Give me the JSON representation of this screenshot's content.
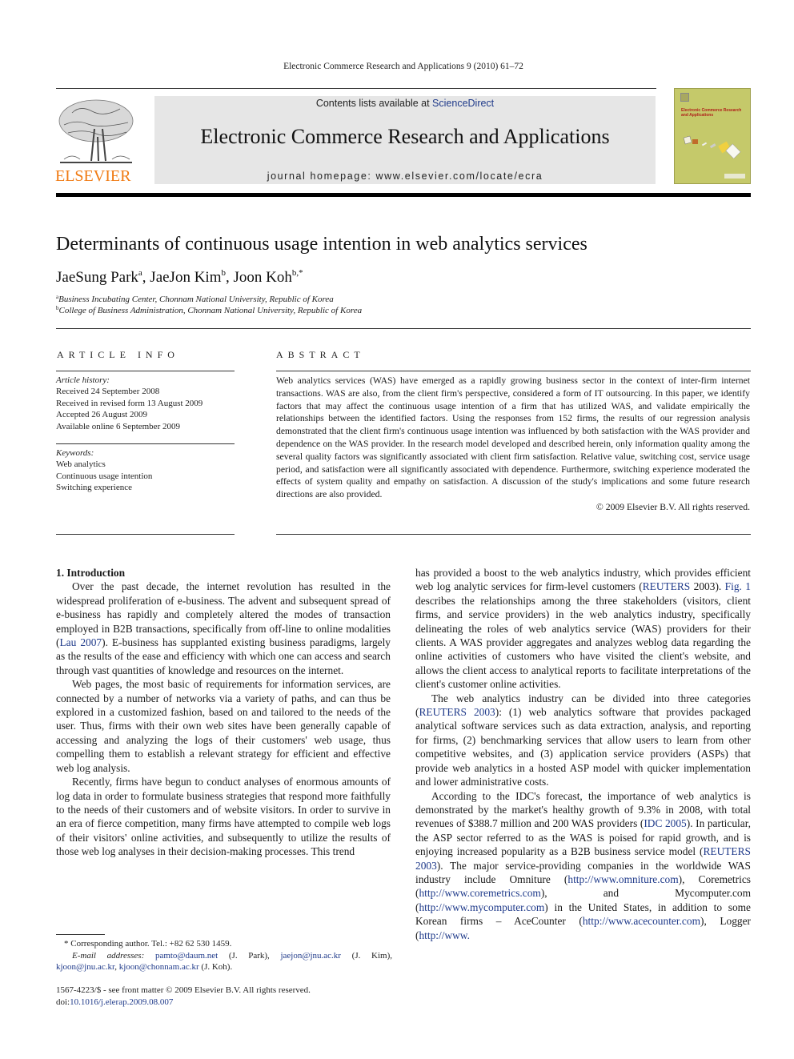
{
  "running_head": "Electronic Commerce Research and Applications 9 (2010) 61–72",
  "masthead": {
    "contents_prefix": "Contents lists available at ",
    "contents_link": "ScienceDirect",
    "journal_title": "Electronic Commerce Research and Applications",
    "homepage": "journal homepage: www.elsevier.com/locate/ecra",
    "publisher_logo": "ELSEVIER",
    "cover_title": "Electronic Commerce Research and Applications"
  },
  "colors": {
    "link": "#1f3a8a",
    "elsevier_orange": "#f07a12",
    "masthead_bg": "#e6e6e6",
    "cover_bg": "#c5c96a"
  },
  "article": {
    "title": "Determinants of continuous usage intention in web analytics services",
    "authors": [
      {
        "name": "JaeSung Park",
        "sup": "a",
        "sep": ", "
      },
      {
        "name": "JaeJon Kim",
        "sup": "b",
        "sep": ", "
      },
      {
        "name": "Joon Koh",
        "sup": "b,*",
        "sep": ""
      }
    ],
    "affiliations": [
      {
        "sup": "a",
        "text": "Business Incubating Center, Chonnam National University, Republic of Korea"
      },
      {
        "sup": "b",
        "text": "College of Business Administration, Chonnam National University, Republic of Korea"
      }
    ]
  },
  "article_info": {
    "heading": "ARTICLE INFO",
    "history_label": "Article history:",
    "history": [
      "Received 24 September 2008",
      "Received in revised form 13 August 2009",
      "Accepted 26 August 2009",
      "Available online 6 September 2009"
    ],
    "keywords_label": "Keywords:",
    "keywords": [
      "Web analytics",
      "Continuous usage intention",
      "Switching experience"
    ]
  },
  "abstract": {
    "heading": "ABSTRACT",
    "text": "Web analytics services (WAS) have emerged as a rapidly growing business sector in the context of inter-firm internet transactions. WAS are also, from the client firm's perspective, considered a form of IT outsourcing. In this paper, we identify factors that may affect the continuous usage intention of a firm that has utilized WAS, and validate empirically the relationships between the identified factors. Using the responses from 152 firms, the results of our regression analysis demonstrated that the client firm's continuous usage intention was influenced by both satisfaction with the WAS provider and dependence on the WAS provider. In the research model developed and described herein, only information quality among the several quality factors was significantly associated with client firm satisfaction. Relative value, switching cost, service usage period, and satisfaction were all significantly associated with dependence. Furthermore, switching experience moderated the effects of system quality and empathy on satisfaction. A discussion of the study's implications and some future research directions are also provided.",
    "copyright": "© 2009 Elsevier B.V. All rights reserved."
  },
  "body": {
    "section_heading": "1. Introduction",
    "left": {
      "p1_a": "Over the past decade, the internet revolution has resulted in the widespread proliferation of e-business. The advent and subsequent spread of e-business has rapidly and completely altered the modes of transaction employed in B2B transactions, specifically from off-line to online modalities (",
      "p1_cite": "Lau 2007",
      "p1_b": "). E-business has supplanted existing business paradigms, largely as the results of the ease and efficiency with which one can access and search through vast quantities of knowledge and resources on the internet.",
      "p2": "Web pages, the most basic of requirements for information services, are connected by a number of networks via a variety of paths, and can thus be explored in a customized fashion, based on and tailored to the needs of the user. Thus, firms with their own web sites have been generally capable of accessing and analyzing the logs of their customers' web usage, thus compelling them to establish a relevant strategy for efficient and effective web log analysis.",
      "p3": "Recently, firms have begun to conduct analyses of enormous amounts of log data in order to formulate business strategies that respond more faithfully to the needs of their customers and of website visitors. In order to survive in an era of fierce competition, many firms have attempted to compile web logs of their visitors' online activities, and subsequently to utilize the results of those web log analyses in their decision-making processes. This trend"
    },
    "right": {
      "p1_a": "has provided a boost to the web analytics industry, which provides efficient web log analytic services for firm-level customers (",
      "p1_cite1": "REUTERS",
      "p1_b": " 2003). ",
      "p1_fig": "Fig. 1",
      "p1_c": " describes the relationships among the three stakeholders (visitors, client firms, and service providers) in the web analytics industry, specifically delineating the roles of web analytics service (WAS) providers for their clients. A WAS provider aggregates and analyzes weblog data regarding the online activities of customers who have visited the client's website, and allows the client access to analytical reports to facilitate interpretations of the client's customer online activities.",
      "p2_a": "The web analytics industry can be divided into three categories (",
      "p2_cite": "REUTERS 2003",
      "p2_b": "): (1) web analytics software that provides packaged analytical software services such as data extraction, analysis, and reporting for firms, (2) benchmarking services that allow users to learn from other competitive websites, and (3) application service providers (ASPs) that provide web analytics in a hosted ASP model with quicker implementation and lower administrative costs.",
      "p3_a": "According to the IDC's forecast, the importance of web analytics is demonstrated by the market's healthy growth of 9.3% in 2008, with total revenues of $388.7 million and 200 WAS providers (",
      "p3_cite1": "IDC 2005",
      "p3_b": "). In particular, the ASP sector referred to as the WAS is poised for rapid growth, and is enjoying increased popularity as a B2B business service model (",
      "p3_cite2": "REUTERS 2003",
      "p3_c": "). The major service-providing companies in the worldwide WAS industry include Omniture (",
      "url1": "http://www.omniture.com",
      "p3_d": "), Coremetrics (",
      "url2": "http://www.coremetrics.com",
      "p3_e": "), and Mycomputer.com (",
      "url3": "http://www.mycomputer.com",
      "p3_f": ") in the United States, in addition to some Korean firms – AceCounter (",
      "url4": "http://www.acecounter.com",
      "p3_g": "), Logger (",
      "url5": "http://www."
    }
  },
  "footnote": {
    "star": "*",
    "corresponding": "Corresponding author. Tel.: +82 62 530 1459.",
    "email_label": "E-mail addresses:",
    "emails": [
      {
        "addr": "pamto@daum.net",
        "who": " (J. Park), "
      },
      {
        "addr": "jaejon@jnu.ac.kr",
        "who": " (J. Kim), "
      },
      {
        "addr": "kjoon@jnu.ac.kr",
        "who": ", "
      },
      {
        "addr": "kjoon@chonnam.ac.kr",
        "who": " (J. Koh)."
      }
    ]
  },
  "front_matter": {
    "issn_line": "1567-4223/$ - see front matter © 2009 Elsevier B.V. All rights reserved.",
    "doi_prefix": "doi:",
    "doi": "10.1016/j.elerap.2009.08.007"
  }
}
